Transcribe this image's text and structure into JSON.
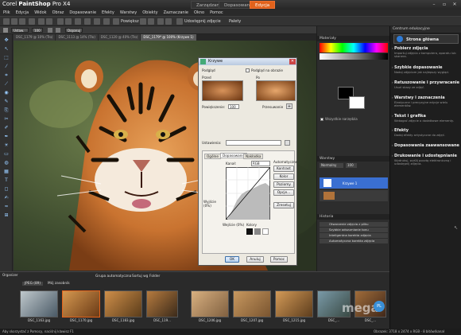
{
  "app": {
    "title_plain": "Corel ",
    "title_bold": "PaintShop",
    "title_rest": " Pro X4"
  },
  "workspace_tabs": [
    {
      "label": "Zarządzanie"
    },
    {
      "label": "Dopasowanie"
    },
    {
      "label": "Edycja"
    }
  ],
  "menu": [
    {
      "label": "Plik"
    },
    {
      "label": "Edycja"
    },
    {
      "label": "Widok"
    },
    {
      "label": "Obraz"
    },
    {
      "label": "Dopasowanie"
    },
    {
      "label": "Efekty"
    },
    {
      "label": "Warstwy"
    },
    {
      "label": "Obiekty"
    },
    {
      "label": "Zaznaczanie"
    },
    {
      "label": "Okno"
    },
    {
      "label": "Pomoc"
    }
  ],
  "toolbar": {
    "zoom_label": "Powiększ",
    "share_label": "Udostępnij zdjęcie",
    "palettes_label": "Palety"
  },
  "tool_options": {
    "preset": "Ustaw.",
    "zoom_value": "100",
    "fit_label": "Dopasuj"
  },
  "doc_tabs": [
    {
      "label": "DSC_1179 @ 10% (Tło)"
    },
    {
      "label": "DSC_1113 @ 14% (Tło)"
    },
    {
      "label": "DSC_1120 @ 40% (Tło)"
    },
    {
      "label": "DSC_1179* @ 100% (Krzywe 1)"
    }
  ],
  "dialog": {
    "title": "Krzywe",
    "preview_label": "Podgląd",
    "preview_on_image": "Podgląd na obrazie",
    "before_label": "Przed",
    "after_label": "Po",
    "zoom_label": "Powiększenie:",
    "zoom_value": "100",
    "pan_label": "Przesuwanie",
    "settings_label": "Ustawienia:",
    "tabs": [
      {
        "label": "Ogólne"
      },
      {
        "label": "Dopasowanie"
      },
      {
        "label": "Nakładka"
      }
    ],
    "channel_label": "Kanał:",
    "channel_value": "RGB",
    "auto_label": "Automatyczne",
    "auto_buttons": [
      {
        "label": "Kontrast"
      },
      {
        "label": "Kolor"
      },
      {
        "label": "Poziomy"
      },
      {
        "label": "Opcje..."
      }
    ],
    "reset_label": "Zresetuj",
    "output_label": "Wyjście (0%)",
    "input_label": "Wejście (0%)",
    "colors_label": "Kolory",
    "ok_label": "OK",
    "cancel_label": "Anuluj",
    "help_label": "Pomoc"
  },
  "right_panels": {
    "materials_title": "Materiały",
    "all_tools_label": "Wszystkie narzędzia",
    "layers_title": "Warstwy",
    "blend_mode": "Normalny",
    "opacity": "100",
    "layer_name": "Krzywe 1",
    "history_title": "Historia",
    "history_items": [
      {
        "label": "Otworzenie zdjęcia z pliku"
      },
      {
        "label": "Szybkie odszumianie tonu"
      },
      {
        "label": "Inteligentna korekta zdjęcia"
      },
      {
        "label": "Automatyczna korekta zdjęcia"
      }
    ]
  },
  "learning_center": {
    "panel_title": "Centrum edukacyjne",
    "home": "Strona główna",
    "sections": [
      {
        "title": "Pobierz zdjęcia",
        "desc": "Importuj zdjęcia z komputera, aparatu lub skanera."
      },
      {
        "title": "Szybkie dopasowanie",
        "desc": "Nadaj zdjęciom jak najlepszy wygląd."
      },
      {
        "title": "Retuszowanie i przywracanie",
        "desc": "Usuń skazy ze zdjęć."
      },
      {
        "title": "Warstwy i zaznaczenia",
        "desc": "Elastyczne i precyzyjne edycje wielu elementów."
      },
      {
        "title": "Tekst i grafika",
        "desc": "Wzbogać zdjęcie o dodatkowe elementy."
      },
      {
        "title": "Efekty",
        "desc": "Dodaj efekty artystyczne do zdjęć."
      },
      {
        "title": "Dopasowania zaawansowane",
        "desc": ""
      },
      {
        "title": "Drukowanie i udostępnianie",
        "desc": "Wydrukuj, wyślij pocztą elektroniczną i udostępnij zdjęcia."
      }
    ]
  },
  "organizer": {
    "tabs": [
      {
        "label": "JPEG (89)"
      },
      {
        "label": "Mój zasobnik"
      }
    ],
    "toolbar_items": [
      {
        "label": "Grupa automatyczna"
      },
      {
        "label": "Sortuj wg"
      },
      {
        "label": "Folder"
      }
    ],
    "thumbs": [
      {
        "label": "DSC_1163.jpg"
      },
      {
        "label": "DSC_1170.jpg"
      },
      {
        "label": "DSC_1183.jpg"
      },
      {
        "label": "DSC_119..."
      },
      {
        "label": "DSC_1206.jpg"
      },
      {
        "label": "DSC_1207.jpg"
      },
      {
        "label": "DSC_1215.jpg"
      },
      {
        "label": "DSC_..."
      },
      {
        "label": "DSC_..."
      }
    ]
  },
  "status": {
    "left": "Aby skorzystać z Pomocy, naciśnij klawisz F1",
    "right": "Obrazek: 3718 x 2474 x RGB - 8 bitów/kanał"
  },
  "watermark": "mega"
}
